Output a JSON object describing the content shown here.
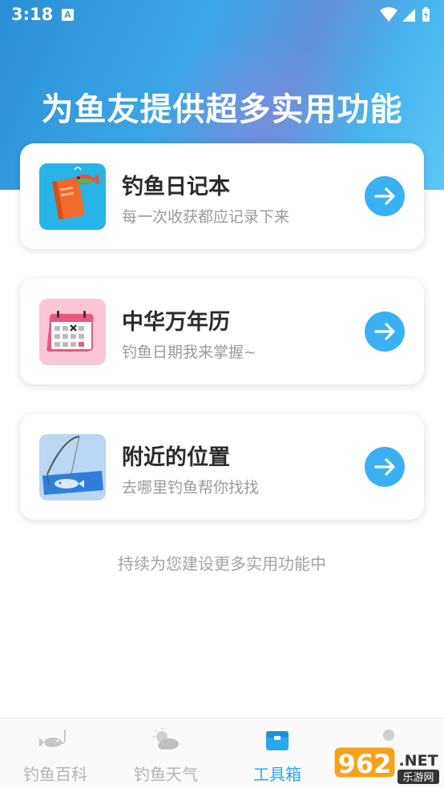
{
  "status_bar": {
    "time": "3:18",
    "notif_letter": "A"
  },
  "hero": {
    "title": "为鱼友提供超多实用功能"
  },
  "cards": [
    {
      "title": "钓鱼日记本",
      "subtitle": "每一次收获都应记录下来",
      "icon": "fishing-diary-icon"
    },
    {
      "title": "中华万年历",
      "subtitle": "钓鱼日期我来掌握~",
      "icon": "calendar-icon"
    },
    {
      "title": "附近的位置",
      "subtitle": "去哪里钓鱼帮你找找",
      "icon": "fishing-location-icon"
    }
  ],
  "footer_note": "持续为您建设更多实用功能中",
  "tabs": [
    {
      "label": "钓鱼百科",
      "icon": "fish-hook-icon",
      "active": false
    },
    {
      "label": "钓鱼天气",
      "icon": "weather-icon",
      "active": false
    },
    {
      "label": "工具箱",
      "icon": "toolbox-icon",
      "active": true
    },
    {
      "label": "",
      "icon": "profile-icon",
      "active": false
    }
  ],
  "watermark": {
    "text": "962",
    "suffix": ".NET",
    "sub": "乐游网"
  },
  "colors": {
    "accent": "#3ab1f3",
    "header_start": "#2c8fd6",
    "header_end": "#5cc6f4"
  }
}
